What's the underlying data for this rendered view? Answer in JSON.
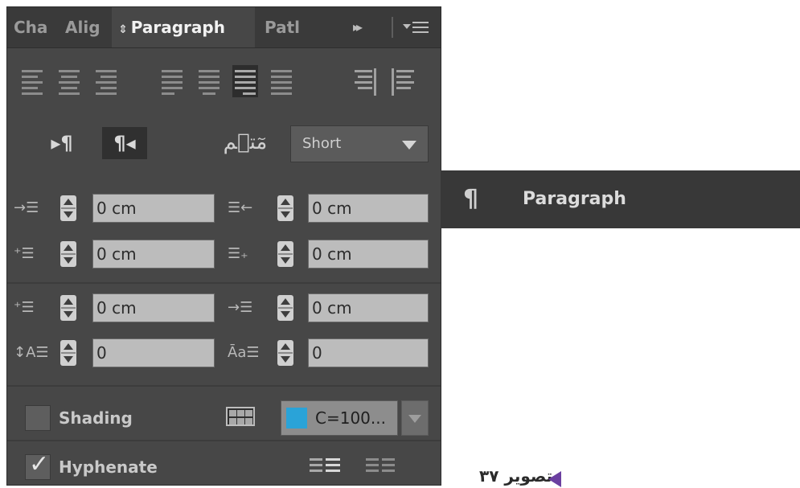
{
  "tabs": [
    {
      "label": "Cha"
    },
    {
      "label": "Alig"
    },
    {
      "label": "Paragraph",
      "active": true
    },
    {
      "label": "Patl"
    }
  ],
  "tab_overflow_label": "▸▸",
  "direction_left_label": "▸¶",
  "direction_right_label": "¶◂",
  "justification_icon_label": "مٓتٖم",
  "justification": {
    "value": "Short"
  },
  "fields": {
    "left_indent": "0 cm",
    "right_indent": "0 cm",
    "first_line_indent": "0 cm",
    "last_line_indent": "0 cm",
    "space_before": "0 cm",
    "space_after": "0 cm",
    "drop_cap_lines": "0",
    "drop_cap_chars": "0"
  },
  "shading": {
    "label": "Shading",
    "checked": false,
    "color_value": "C=100...",
    "color_hex": "#2aa3d8"
  },
  "hyphenate": {
    "label": "Hyphenate",
    "checked": true
  },
  "collapsed_panel": {
    "icon": "¶",
    "label": "Paragraph"
  },
  "caption": {
    "text": "تصویر ۳۷"
  },
  "colors": {
    "panel_bg": "#474747",
    "accent_purple": "#6b3fa0"
  }
}
